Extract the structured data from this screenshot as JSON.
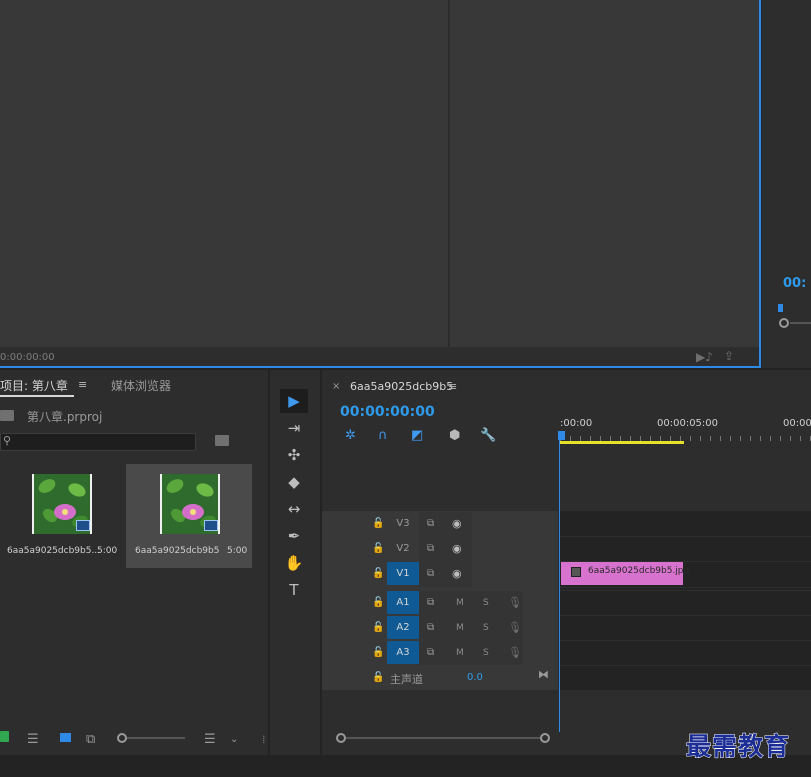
{
  "source_monitor": {
    "timecode": "0:00:00:00"
  },
  "program_monitor": {
    "timecode": "00:"
  },
  "project_panel": {
    "tab_label": "项目: 第八章",
    "menu_glyph": "≡",
    "media_browser_tab": "媒体浏览器",
    "project_file": "第八章.prproj",
    "search_placeholder": "",
    "items": [
      {
        "name": "6aa5a9025dcb9b5...",
        "duration": "5:00"
      },
      {
        "name": "6aa5a9025dcb9b5",
        "duration": "5:00"
      }
    ]
  },
  "tools": [
    {
      "name": "selection-tool",
      "glyph": "▶"
    },
    {
      "name": "track-select-tool",
      "glyph": "⇥"
    },
    {
      "name": "ripple-edit-tool",
      "glyph": "✣"
    },
    {
      "name": "razor-tool",
      "glyph": "◆"
    },
    {
      "name": "slip-tool",
      "glyph": "↔"
    },
    {
      "name": "pen-tool",
      "glyph": "✒"
    },
    {
      "name": "hand-tool",
      "glyph": "✋"
    },
    {
      "name": "type-tool",
      "glyph": "T"
    }
  ],
  "timeline": {
    "close_glyph": "×",
    "sequence_name": "6aa5a9025dcb9b5",
    "menu_glyph": "≡",
    "timecode": "00:00:00:00",
    "ruler_labels": [
      ":00:00",
      "00:00:05:00",
      "00:00"
    ],
    "video_tracks": [
      "V3",
      "V2",
      "V1"
    ],
    "audio_tracks": [
      "A1",
      "A2",
      "A3"
    ],
    "mute_label": "M",
    "solo_label": "S",
    "master_label": "主声道",
    "master_value": "0.0",
    "clip_name": "6aa5a9025dcb9b5.jpg"
  },
  "watermark": "最需教育",
  "colors": {
    "accent": "#2e8ae6",
    "clip": "#d872cf",
    "work_area": "#e5e02a",
    "active_track": "#0f5a94"
  }
}
